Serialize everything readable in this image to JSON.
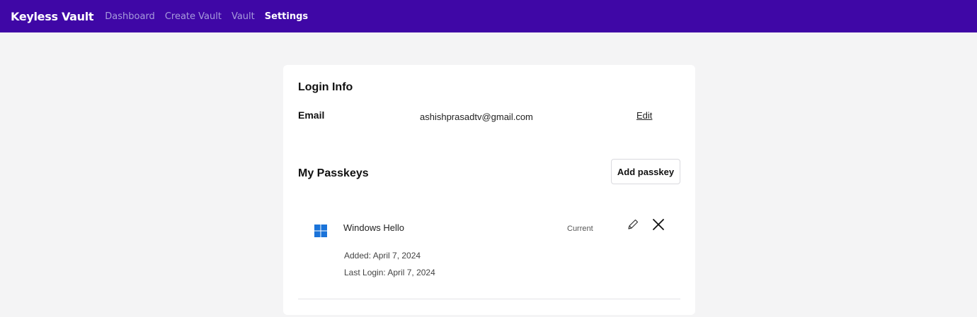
{
  "navbar": {
    "brand": "Keyless Vault",
    "links": [
      {
        "label": "Dashboard"
      },
      {
        "label": "Create Vault"
      },
      {
        "label": "Vault"
      },
      {
        "label": "Settings",
        "active": true
      }
    ],
    "background_color": "#3f07a6"
  },
  "login_info": {
    "title": "Login Info",
    "email_label": "Email",
    "email_value": "ashishprasadtv@gmail.com",
    "edit_label": "Edit"
  },
  "passkeys": {
    "title": "My Passkeys",
    "add_button_label": "Add passkey",
    "items": [
      {
        "icon": "windows-icon",
        "name": "Windows Hello",
        "badge": "Current",
        "added": "Added: April 7, 2024",
        "last_login": "Last Login: April 7, 2024"
      }
    ]
  }
}
